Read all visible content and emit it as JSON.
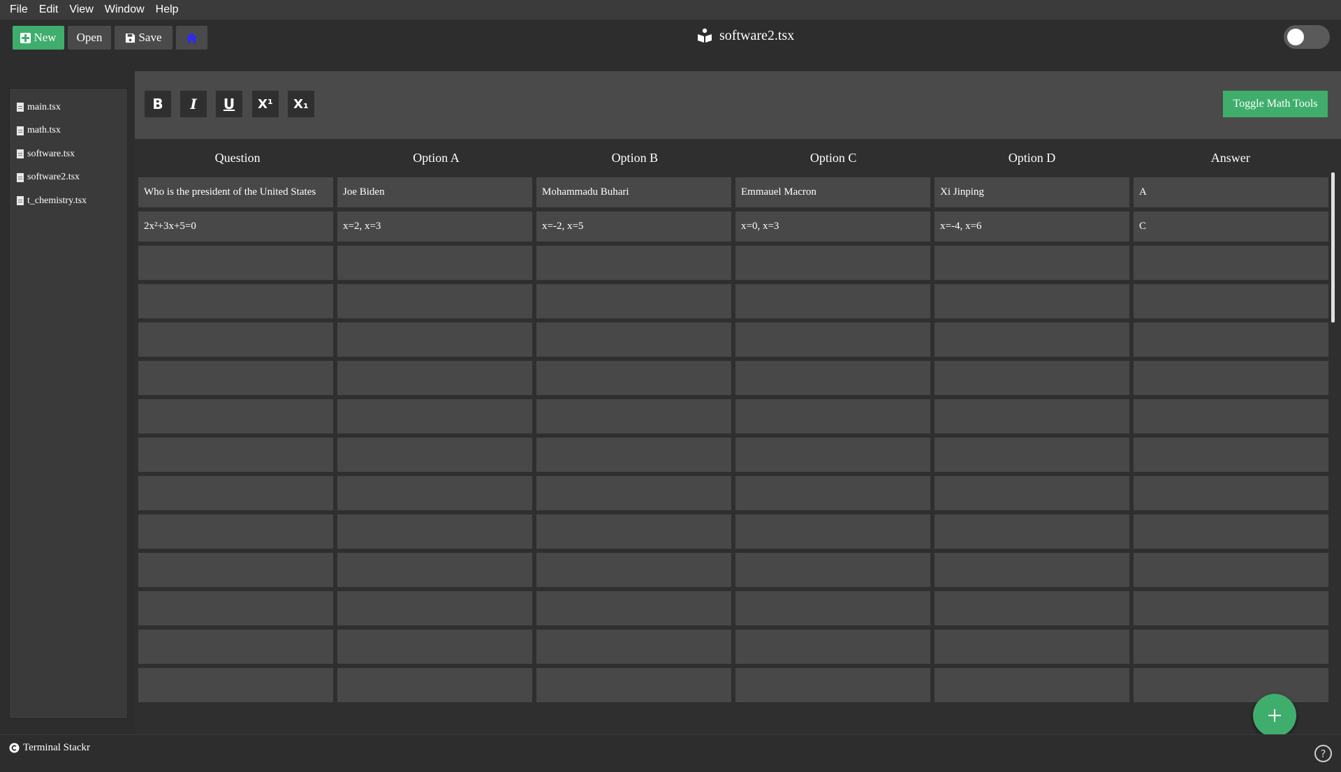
{
  "menu": [
    "File",
    "Edit",
    "View",
    "Window",
    "Help"
  ],
  "toolbar": {
    "new_label": "New",
    "open_label": "Open",
    "save_label": "Save"
  },
  "window_title": "software2.tsx",
  "files": [
    "main.tsx",
    "math.tsx",
    "software.tsx",
    "software2.tsx",
    "t_chemistry.tsx"
  ],
  "format": {
    "bold": "B",
    "italic": "I",
    "underline": "U",
    "superscript": "X¹",
    "subscript": "X₁",
    "math_tools_label": "Toggle Math Tools"
  },
  "table": {
    "headers": [
      "Question",
      "Option A",
      "Option B",
      "Option C",
      "Option D",
      "Answer"
    ],
    "rows": [
      [
        "Who is the president of the United States",
        "Joe Biden",
        "Mohammadu Buhari",
        "Emmauel Macron",
        "Xi Jinping",
        "A"
      ],
      [
        "2x²+3x+5=0",
        "x=2, x=3",
        "x=-2, x=5",
        "x=0, x=3",
        "x=-4, x=6",
        "C"
      ]
    ],
    "empty_rows": 12
  },
  "footer": {
    "brand": "Terminal Stackr",
    "help": "?"
  },
  "colors": {
    "accent": "#3fae6c",
    "home_icon": "#2a2cf0"
  }
}
